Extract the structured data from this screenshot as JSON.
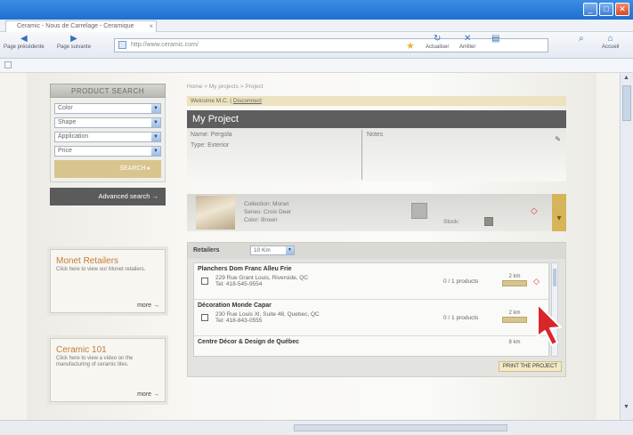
{
  "browser": {
    "tab_title": "Ceramic - Nous de Carrelage - Ceramique",
    "address": "http://www.ceramic.com/",
    "toolbar": {
      "back_label": "Page précédente",
      "forward_label": "Page suivante",
      "refresh_label": "Actualiser",
      "stop_label": "Arrêter",
      "home_label": "Accueil"
    }
  },
  "sidebar": {
    "search_header": "PRODUCT SEARCH",
    "filters": [
      {
        "value": "Color"
      },
      {
        "value": "Shape"
      },
      {
        "value": "Application"
      },
      {
        "value": "Price"
      }
    ],
    "search_label": "SEARCH",
    "advanced_label": "Advanced search →",
    "promos": [
      {
        "title": "Monet Retailers",
        "text": "Click here to view our Monet retailers.",
        "more": "more →"
      },
      {
        "title": "Ceramic 101",
        "text": "Click here to view a video on the manufacturing of ceramic tiles.",
        "more": "more →"
      }
    ]
  },
  "main": {
    "breadcrumb": "Home > My projects > Project",
    "welcome_text": "Welcome M.C.  |",
    "logout_label": "Disconnect",
    "title": "My Project",
    "project_name": "Name: Pergola",
    "project_type": "Type: Exterior",
    "notes_label": "Notes",
    "item": {
      "collection": "Collection: Monet",
      "series": "Series: Croix Deer",
      "color": "Color: Brown",
      "stock_label": "Stock:"
    },
    "retailers_label": "Retailers",
    "radius_value": "10 Km",
    "retailers": [
      {
        "name": "Planchers Dom Franc Alleu Frie",
        "address": "229 Rue Grant Louis, Riverside, QC",
        "phone": "Tel: 418-545-9554",
        "products": "0 / 1 products",
        "distance": "2 km"
      },
      {
        "name": "Décoration Monde Capar",
        "address": "230 Rue Louis Xl, Suite 48, Quebec, QC",
        "phone": "Tel: 418-843-0555",
        "products": "0 / 1 products",
        "distance": "2 km"
      },
      {
        "name": "Centre Décor & Design de Québec",
        "address": "",
        "phone": "",
        "products": "",
        "distance": "8 km"
      }
    ],
    "print_label": "PRINT THE PROJECT"
  },
  "colors": {
    "accent_gold": "#d8c58e",
    "dark_gray": "#5e5e5e",
    "remove_red": "#e23b2e",
    "promo_orange": "#c57c35"
  }
}
